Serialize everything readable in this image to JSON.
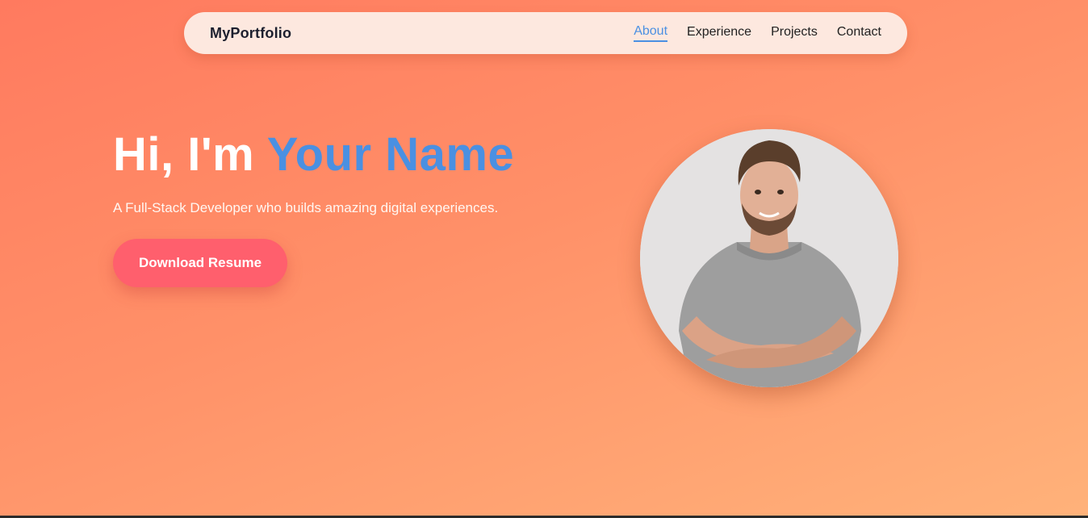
{
  "nav": {
    "brand": "MyPortfolio",
    "links": [
      {
        "label": "About",
        "active": true
      },
      {
        "label": "Experience",
        "active": false
      },
      {
        "label": "Projects",
        "active": false
      },
      {
        "label": "Contact",
        "active": false
      }
    ]
  },
  "hero": {
    "greeting": "Hi, I'm ",
    "name": "Your Name",
    "subtitle": "A Full-Stack Developer who builds amazing digital experiences.",
    "button_label": "Download Resume"
  },
  "colors": {
    "accent": "#4a90e2",
    "button": "#ff5f6d",
    "gradient_start": "#ff7a5f",
    "gradient_end": "#ffb27a",
    "navbar_bg": "#fde8df"
  },
  "icons": {
    "avatar": "profile-photo"
  }
}
